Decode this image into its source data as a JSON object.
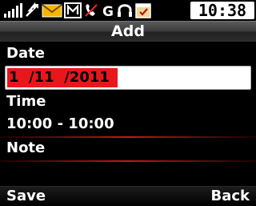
{
  "status": {
    "time": "10:38",
    "icons": [
      "signal-strength-icon",
      "data-transfer-icon",
      "message-envelope-icon",
      "multimedia-m-icon",
      "no-call-icon",
      "network-g-icon",
      "headset-icon",
      "calendar-alarm-icon"
    ]
  },
  "header": {
    "title": "Add"
  },
  "form": {
    "date_label": "Date",
    "date_value": "1  /11  /2011",
    "time_label": "Time",
    "time_value": "10:00 - 10:00",
    "note_label": "Note"
  },
  "softkeys": {
    "left": "Save",
    "right": "Back"
  },
  "colors": {
    "selection": "#e8171b",
    "separator": "#c21a1a",
    "background": "#000000"
  }
}
